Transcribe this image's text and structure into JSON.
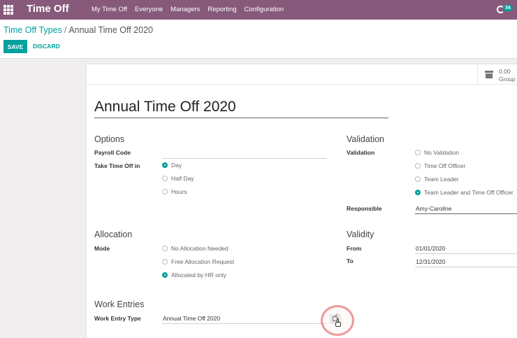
{
  "navbar": {
    "app_name": "Time Off",
    "menu": [
      "My Time Off",
      "Everyone",
      "Managers",
      "Reporting",
      "Configuration"
    ],
    "activity_count": "34"
  },
  "breadcrumb": {
    "parent": "Time Off Types",
    "separator": "/",
    "current": "Annual Time Off 2020"
  },
  "actions": {
    "save": "SAVE",
    "discard": "DISCARD"
  },
  "smart_button": {
    "value": "0.00",
    "label": "Group Ti"
  },
  "form": {
    "title": "Annual Time Off 2020",
    "options": {
      "heading": "Options",
      "payroll_code_label": "Payroll Code",
      "payroll_code_value": "",
      "take_time_off_label": "Take Time Off in",
      "take_time_off_choices": [
        "Day",
        "Half Day",
        "Hours"
      ],
      "take_time_off_selected": "Day"
    },
    "validation": {
      "heading": "Validation",
      "validation_label": "Validation",
      "choices": [
        "No Validation",
        "Time Off Officer",
        "Team Leader",
        "Team Leader and Time Off Officer"
      ],
      "selected": "Team Leader and Time Off Officer",
      "responsible_label": "Responsible",
      "responsible_value": "Amy-Caroline"
    },
    "allocation": {
      "heading": "Allocation",
      "mode_label": "Mode",
      "choices": [
        "No Allocation Needed",
        "Free Allocation Request",
        "Allocated by HR only"
      ],
      "selected": "Allocated by HR only"
    },
    "validity": {
      "heading": "Validity",
      "from_label": "From",
      "from_value": "01/01/2020",
      "to_label": "To",
      "to_value": "12/31/2020"
    },
    "work_entries": {
      "heading": "Work Entries",
      "type_label": "Work Entry Type",
      "type_value": "Annual Time Off 2020"
    }
  },
  "colors": {
    "navbar": "#875a7b",
    "accent": "#00a09d",
    "click_highlight": "#e57b7b"
  }
}
